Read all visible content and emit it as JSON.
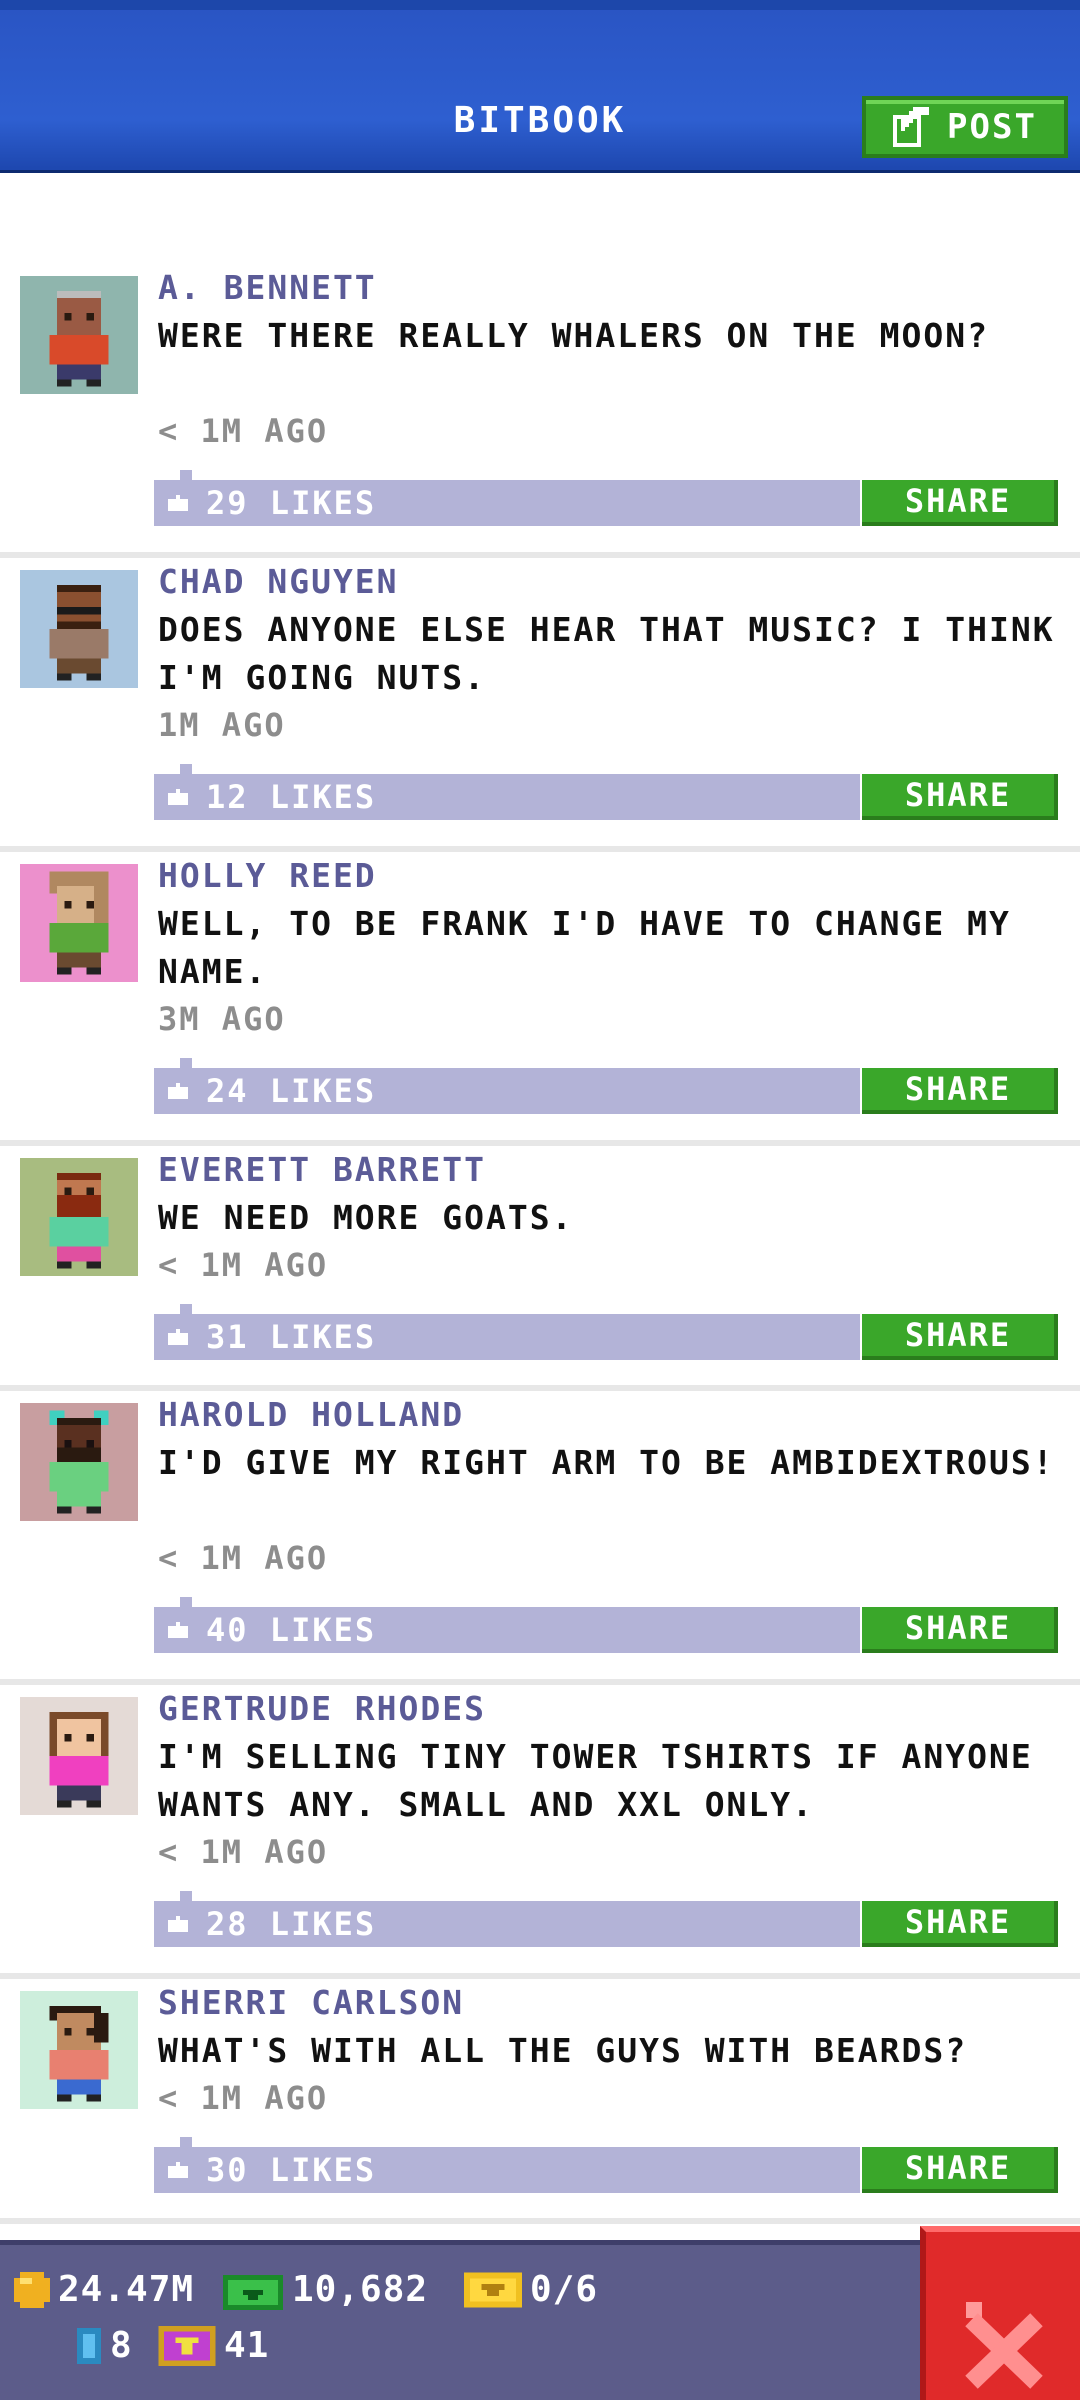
{
  "header": {
    "title": "BITBOOK",
    "post_label": "POST"
  },
  "posts": [
    {
      "author": "A. BENNETT",
      "text": "WERE THERE REALLY WHALERS ON THE MOON?",
      "time": "< 1M AGO",
      "likes": "29 LIKES",
      "share": "SHARE"
    },
    {
      "author": "CHAD NGUYEN",
      "text": "DOES ANYONE ELSE HEAR THAT MUSIC? I THINK I'M GOING NUTS.",
      "time": "1M AGO",
      "likes": "12 LIKES",
      "share": "SHARE"
    },
    {
      "author": "HOLLY REED",
      "text": "WELL, TO BE FRANK I'D HAVE TO CHANGE MY NAME.",
      "time": "3M AGO",
      "likes": "24 LIKES",
      "share": "SHARE"
    },
    {
      "author": "EVERETT BARRETT",
      "text": "WE NEED MORE GOATS.",
      "time": "< 1M AGO",
      "likes": "31 LIKES",
      "share": "SHARE"
    },
    {
      "author": "HAROLD HOLLAND",
      "text": "I'D GIVE MY RIGHT ARM TO BE AMBIDEXTROUS!",
      "time": "< 1M AGO",
      "likes": "40 LIKES",
      "share": "SHARE"
    },
    {
      "author": "GERTRUDE RHODES",
      "text": "I'M SELLING TINY TOWER TSHIRTS IF ANYONE WANTS ANY. SMALL AND XXL ONLY.",
      "time": "< 1M AGO",
      "likes": "28 LIKES",
      "share": "SHARE"
    },
    {
      "author": "SHERRI CARLSON",
      "text": "WHAT'S WITH ALL THE GUYS WITH BEARDS?",
      "time": "< 1M AGO",
      "likes": "30 LIKES",
      "share": "SHARE"
    }
  ],
  "status": {
    "coins": "24.47M",
    "bux": "10,682",
    "tickets": "0/6",
    "elevator": "8",
    "gems": "41"
  },
  "colors": {
    "header_blue": "#2e5fd0",
    "share_green": "#3aa72a",
    "likes_bar": "#b3b3d7",
    "author_purple": "#5b5b97",
    "close_red": "#e02a2a"
  },
  "icons": {
    "post": "edit-icon",
    "like": "thumbs-up-icon",
    "coin": "coin-icon",
    "bux": "bux-icon",
    "ticket": "ticket-icon",
    "elevator": "elevator-icon",
    "gem": "gem-icon",
    "close": "close-icon"
  }
}
